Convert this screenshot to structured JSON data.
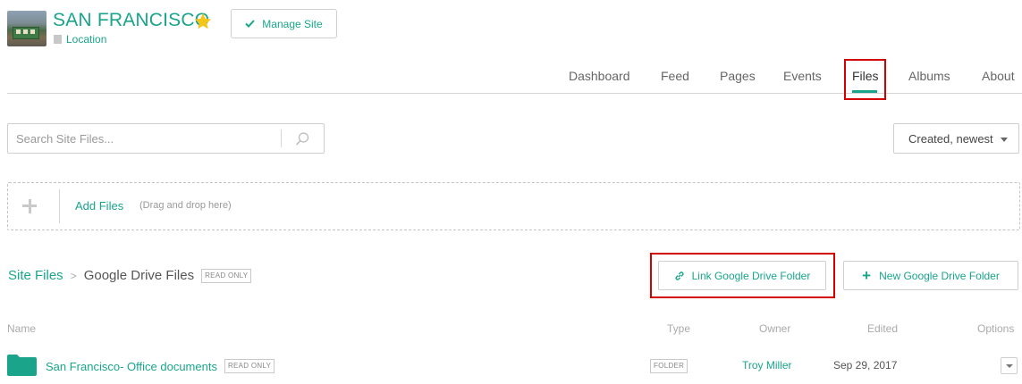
{
  "header": {
    "site_title": "SAN FRANCISCO",
    "location": "Location",
    "manage_label": "Manage Site",
    "star_color": "#f5c518"
  },
  "nav": {
    "tabs": [
      {
        "label": "Dashboard",
        "active": false
      },
      {
        "label": "Feed",
        "active": false
      },
      {
        "label": "Pages",
        "active": false
      },
      {
        "label": "Events",
        "active": false
      },
      {
        "label": "Files",
        "active": true
      },
      {
        "label": "Albums",
        "active": false
      },
      {
        "label": "About",
        "active": false
      }
    ]
  },
  "search": {
    "placeholder": "Search Site Files...",
    "value": ""
  },
  "sort": {
    "selected": "Created, newest"
  },
  "dropzone": {
    "add_label": "Add Files",
    "hint": "(Drag and drop here)"
  },
  "breadcrumb": {
    "root": "Site Files",
    "separator": ">",
    "current": "Google Drive Files",
    "badge": "READ ONLY"
  },
  "actions": {
    "link_folder": "Link Google Drive Folder",
    "new_folder": "New Google Drive Folder"
  },
  "table": {
    "headers": [
      "Name",
      "Type",
      "Owner",
      "Edited",
      "Options"
    ],
    "rows": [
      {
        "name": "San Francisco- Office documents",
        "badge": "READ ONLY",
        "type": "FOLDER",
        "owner": "Troy Miller",
        "edited": "Sep 29, 2017"
      }
    ]
  },
  "colors": {
    "accent": "#1aa58b",
    "highlight": "#d40000"
  }
}
